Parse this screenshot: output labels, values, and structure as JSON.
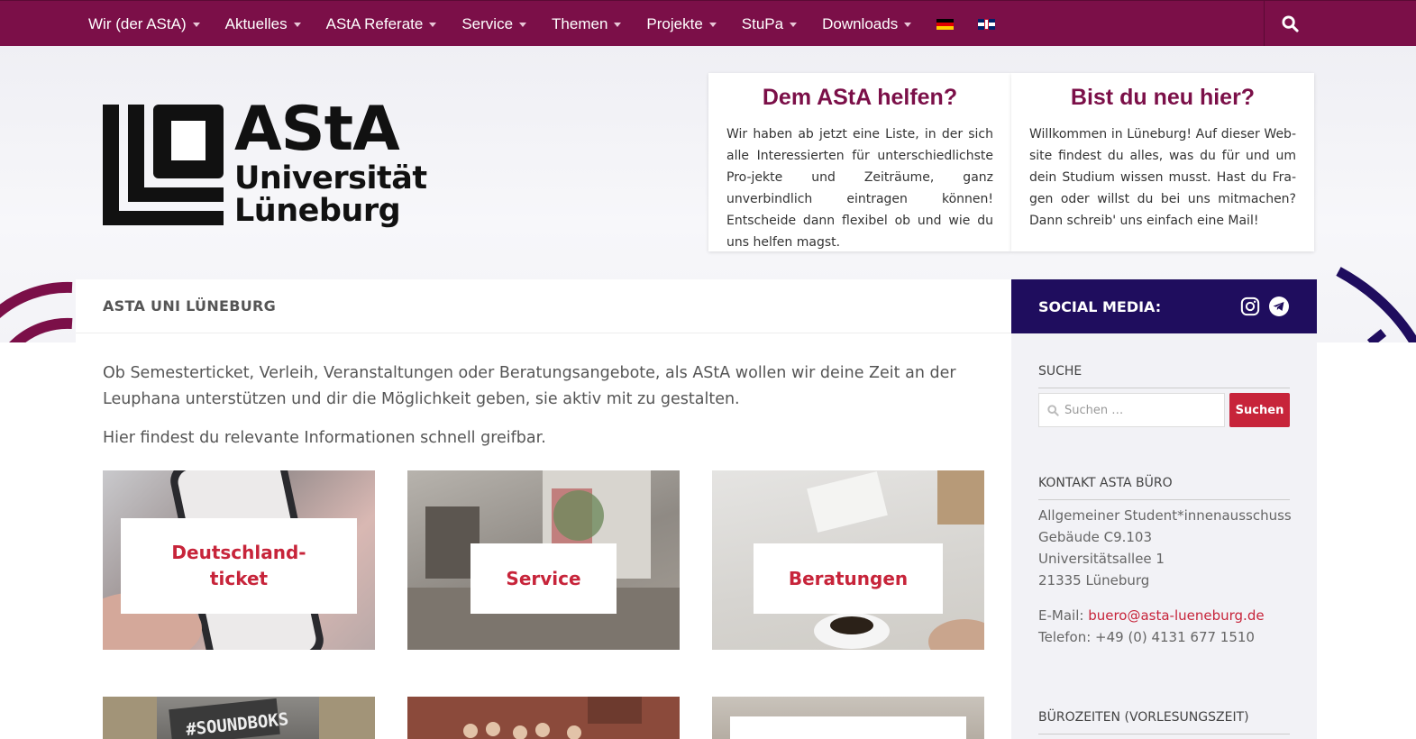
{
  "nav": {
    "items": [
      {
        "label": "Wir (der AStA)"
      },
      {
        "label": "Aktuelles"
      },
      {
        "label": "AStA Referate"
      },
      {
        "label": "Service"
      },
      {
        "label": "Themen"
      },
      {
        "label": "Projekte"
      },
      {
        "label": "StuPa"
      },
      {
        "label": "Downloads"
      }
    ],
    "languages": [
      "de",
      "en"
    ]
  },
  "logo": {
    "line1": "AStA",
    "line2": "Universität",
    "line3": "Lüneburg"
  },
  "cards": [
    {
      "title": "Dem AStA helfen?",
      "text": "Wir haben ab jetzt eine Liste, in der sich alle Interessierten für unterschiedlichste Pro-jekte und Zeiträume, ganz unverbindlich eintragen können! Entscheide dann flexibel ob und wie du uns helfen magst."
    },
    {
      "title": "Bist du neu hier?",
      "text": "Willkommen in Lüneburg! Auf dieser Web-site findest du alles, was du für und um dein Studium wissen musst. Hast du Fra-gen oder willst du bei uns mitmachen? Dann schreib' uns einfach eine Mail!"
    }
  ],
  "main": {
    "page_title": "ASTA UNI LÜNEBURG",
    "intro": "Ob Semesterticket, Verleih, Veranstaltungen oder Beratungsangebote, als AStA wollen wir deine Zeit an der Leuphana unterstützen und dir die Möglichkeit geben, sie aktiv mit zu gestalten.",
    "intro2": "Hier findest du relevante Informationen schnell greifbar.",
    "tiles": [
      {
        "label": "Deutschland-ticket"
      },
      {
        "label": "Service"
      },
      {
        "label": "Beratungen"
      }
    ],
    "tile_row2_text": "#SOUNDBOKS"
  },
  "sidebar": {
    "social_title": "SOCIAL MEDIA:",
    "search_title": "SUCHE",
    "search_placeholder": "Suchen …",
    "search_button": "Suchen",
    "contact_title": "KONTAKT ASTA BÜRO",
    "contact_lines": [
      "Allgemeiner Student*innenausschuss",
      "Gebäude C9.103",
      "Universitätsallee 1",
      "21335 Lüneburg"
    ],
    "email_label": "E-Mail:",
    "email": "buero@asta-lueneburg.de",
    "phone": "Telefon: +49 (0) 4131 677 1510",
    "hours_title": "BÜROZEITEN (VORLESUNGSZEIT)"
  },
  "colors": {
    "brand": "#7b0f48",
    "accent": "#c7243a",
    "social_bg": "#1f0d5e"
  }
}
